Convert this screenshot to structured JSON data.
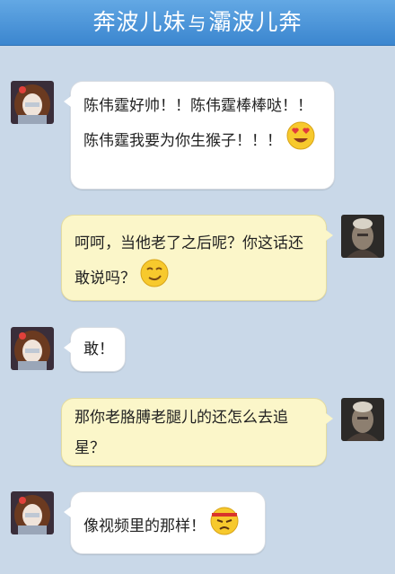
{
  "header": {
    "title_left": "奔波儿妹",
    "title_sep": "与",
    "title_right": "灞波儿奔"
  },
  "colors": {
    "header": "#4a96da",
    "background": "#c9d8e8",
    "bubble_self": "#fbf6c9",
    "bubble_other": "#ffffff"
  },
  "messages": [
    {
      "sender": "girl",
      "text": "陈伟霆好帅！！陈伟霆棒棒哒！！陈伟霆我要为你生猴子！！！",
      "emoji": "heart-eyes-emoji"
    },
    {
      "sender": "old-man",
      "text": "呵呵，当他老了之后呢？你这话还敢说吗？",
      "emoji": "smirk-emoji"
    },
    {
      "sender": "girl",
      "text": "敢！"
    },
    {
      "sender": "old-man",
      "text": "那你老胳膊老腿儿的还怎么去追星？"
    },
    {
      "sender": "girl",
      "text": "像视频里的那样！",
      "emoji": "angry-headband-emoji"
    }
  ]
}
